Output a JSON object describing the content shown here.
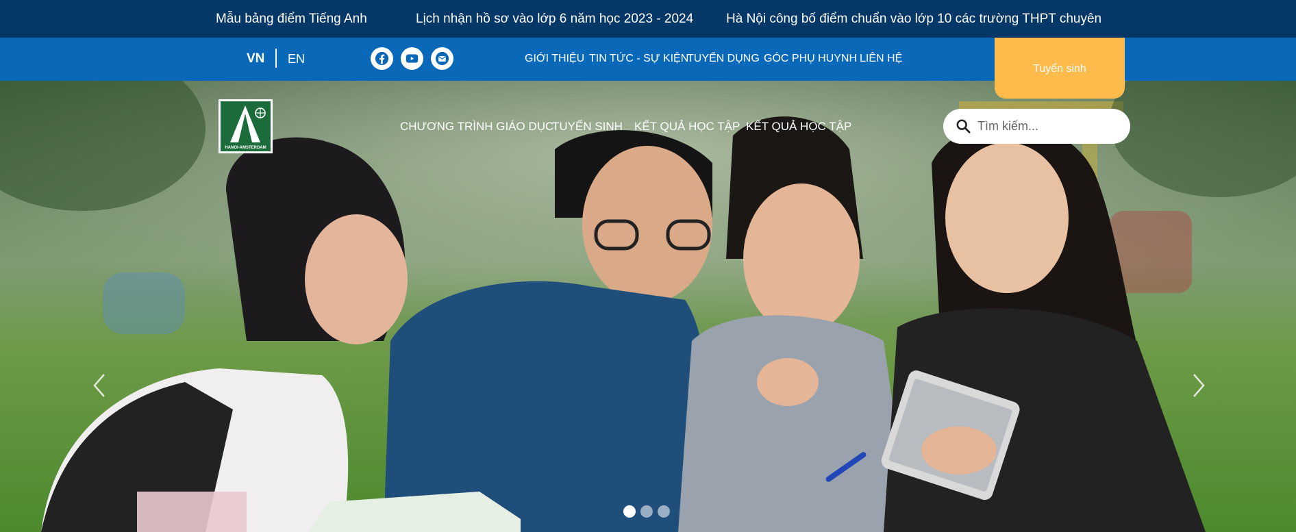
{
  "ticker": [
    "Mẫu bảng điểm Tiếng Anh",
    "Lịch nhận hồ sơ vào lớp 6 năm học 2023 - 2024",
    "Hà Nội công bố điểm chuẩn vào lớp 10 các trường THPT chuyên"
  ],
  "lang": {
    "vn": "VN",
    "en": "EN"
  },
  "social_icons": [
    "facebook-icon",
    "youtube-icon",
    "envelope-icon"
  ],
  "top_nav": [
    "GIỚI THIỆU",
    "TIN TỨC - SỰ KIỆN",
    "TUYỂN DỤNG",
    "GÓC PHỤ HUYNH",
    "LIÊN HỆ"
  ],
  "admission_label": "Tuyển sinh",
  "logo_text": "HANOI-AMSTERDAM",
  "main_nav": [
    "CHƯƠNG TRÌNH GIÁO DỤC",
    "TUYỂN SINH",
    "KẾT QUẢ HỌC TẬP",
    "KẾT QUẢ HỌC TẬP"
  ],
  "search": {
    "placeholder": "Tìm kiếm..."
  },
  "slider": {
    "slide_count": 3,
    "active_index": 0
  },
  "colors": {
    "ticker_bg": "#053767",
    "nav_bg": "#0969b8",
    "accent": "#fdbb4b"
  }
}
